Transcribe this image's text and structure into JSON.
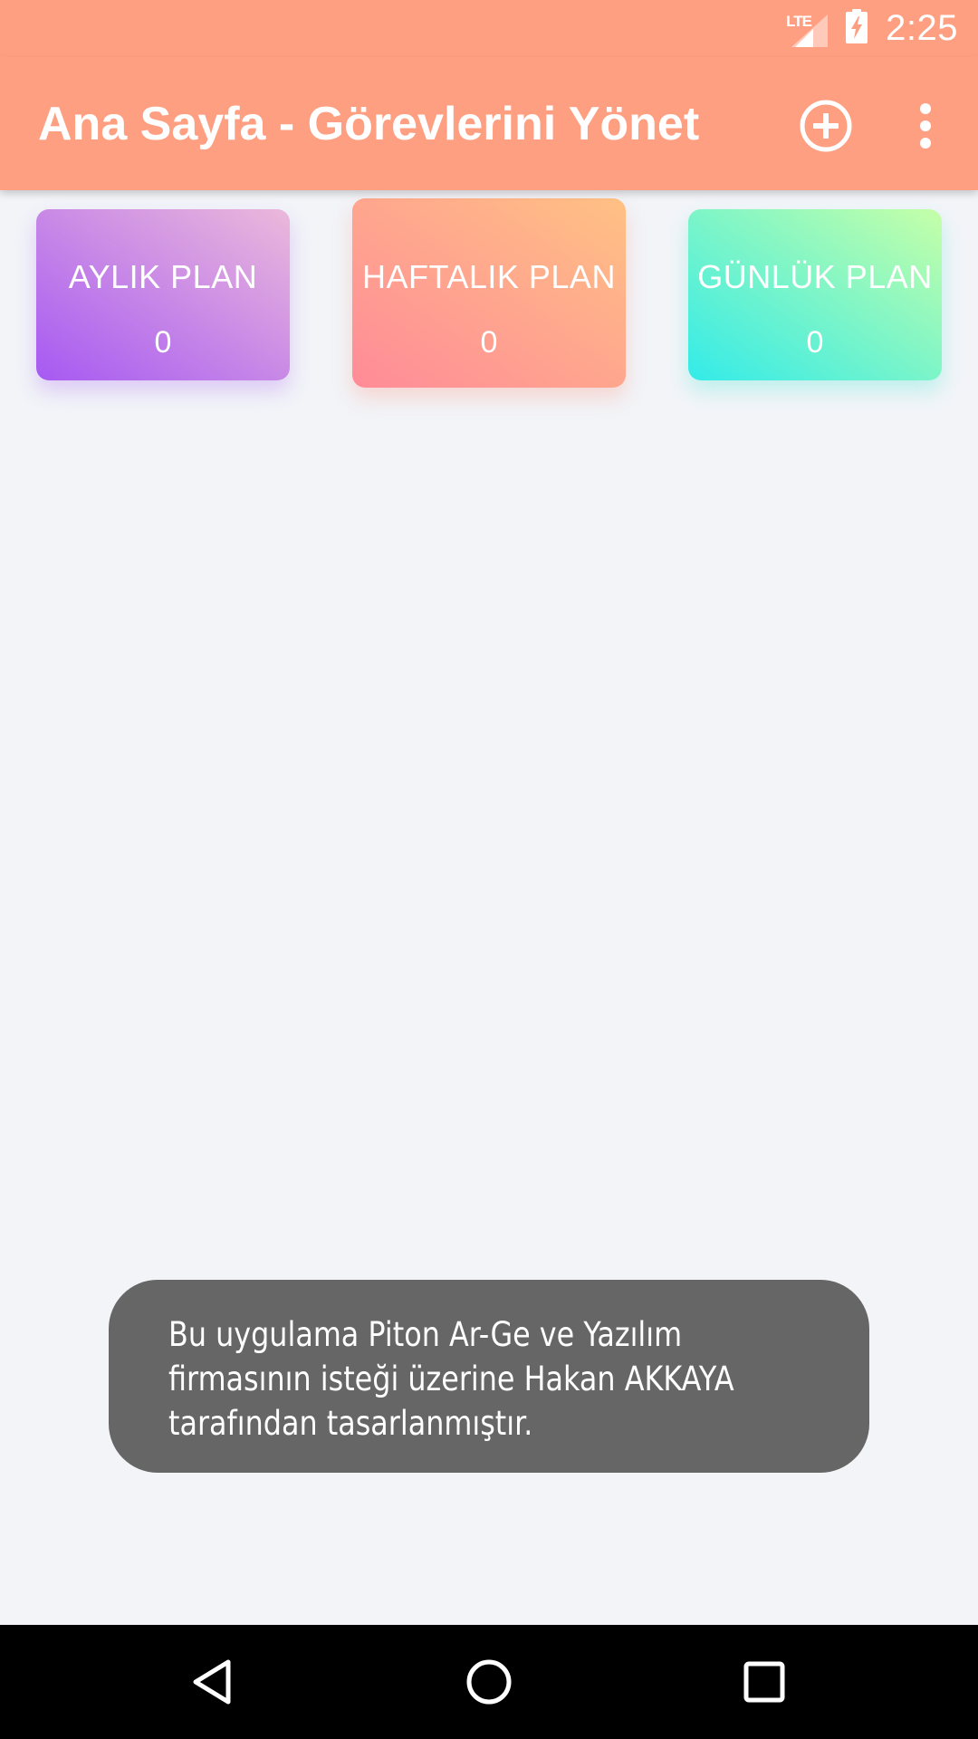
{
  "status_bar": {
    "network_label": "LTE",
    "time": "2:25"
  },
  "app_bar": {
    "title": "Ana Sayfa - Görevlerini Yönet",
    "actions": [
      {
        "icon": "add-circle-icon"
      },
      {
        "icon": "more-vert-icon"
      }
    ]
  },
  "cards": [
    {
      "title": "AYLIK PLAN",
      "count": "0"
    },
    {
      "title": "HAFTALIK PLAN",
      "count": "0"
    },
    {
      "title": "GÜNLÜK PLAN",
      "count": "0"
    }
  ],
  "toast": {
    "lines": [
      "Bu uygulama Piton Ar-Ge ve Yazılım",
      "firmasının isteği üzerine Hakan AKKAYA",
      "tarafından tasarlanmıştır."
    ]
  },
  "nav_bar": {
    "buttons": [
      {
        "icon": "back-icon"
      },
      {
        "icon": "home-icon"
      },
      {
        "icon": "recents-icon"
      }
    ]
  },
  "colors": {
    "app_bar": "#ff9f82",
    "background": "#f2f4f8",
    "toast": "#666666",
    "monthly_gradient": [
      "#a659f2",
      "#ebb9db"
    ],
    "weekly_gradient": [
      "#ff8b98",
      "#ffc184"
    ],
    "daily_gradient": [
      "#33ebe8",
      "#c6ffa8"
    ]
  }
}
